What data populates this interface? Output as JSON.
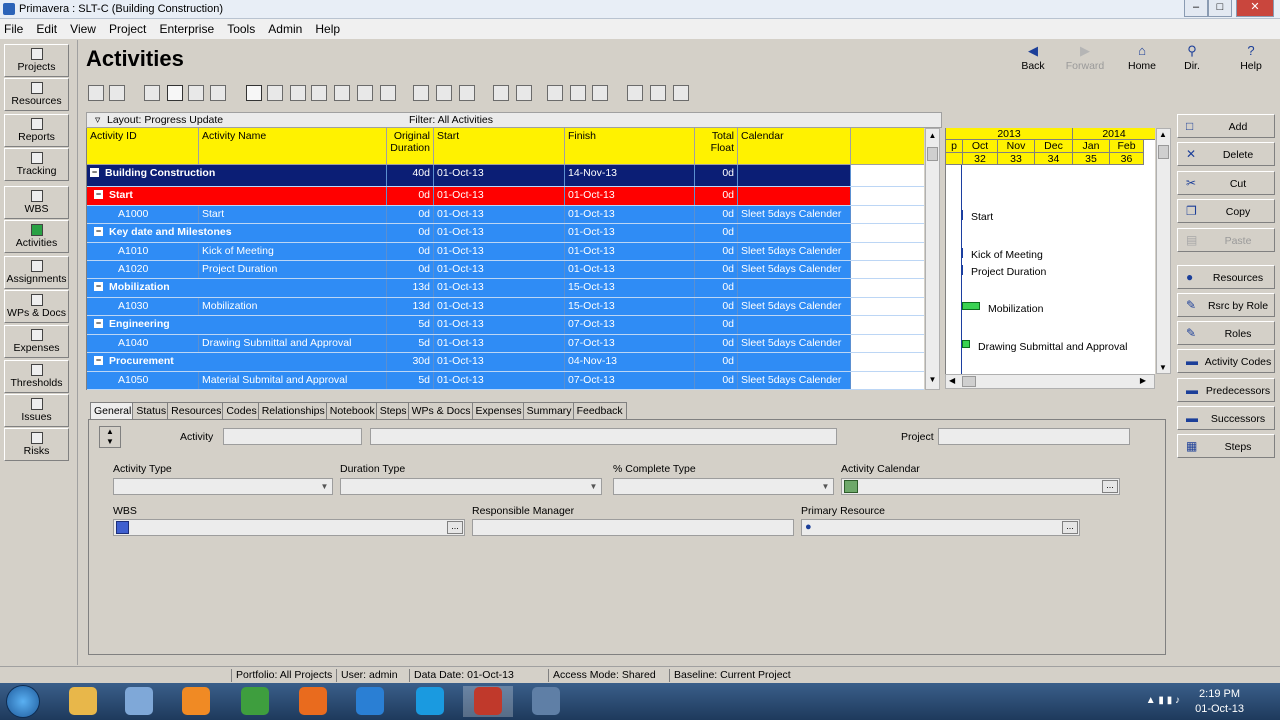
{
  "window": {
    "title": "Primavera : SLT-C (Building Construction)"
  },
  "menu": [
    "File",
    "Edit",
    "View",
    "Project",
    "Enterprise",
    "Tools",
    "Admin",
    "Help"
  ],
  "leftnav": [
    {
      "label": "Projects",
      "icon": "projects-icon"
    },
    {
      "label": "Resources",
      "icon": "resources-icon"
    },
    {
      "label": "Reports",
      "icon": "reports-icon"
    },
    {
      "label": "Tracking",
      "icon": "tracking-icon"
    },
    {
      "label": "WBS",
      "icon": "wbs-icon"
    },
    {
      "label": "Activities",
      "icon": "activities-icon"
    },
    {
      "label": "Assignments",
      "icon": "assignments-icon"
    },
    {
      "label": "WPs & Docs",
      "icon": "wps-docs-icon"
    },
    {
      "label": "Expenses",
      "icon": "expenses-icon"
    },
    {
      "label": "Thresholds",
      "icon": "thresholds-icon"
    },
    {
      "label": "Issues",
      "icon": "issues-icon"
    },
    {
      "label": "Risks",
      "icon": "risks-icon"
    }
  ],
  "header": {
    "title": "Activities",
    "nav": [
      {
        "label": "Back",
        "icon": "back-icon",
        "glyph": "◀",
        "disabled": false
      },
      {
        "label": "Forward",
        "icon": "forward-icon",
        "glyph": "▶",
        "disabled": true
      },
      {
        "label": "Home",
        "icon": "home-icon",
        "glyph": "⌂",
        "disabled": false
      },
      {
        "label": "Dir.",
        "icon": "directory-icon",
        "glyph": "⚲",
        "disabled": false
      },
      {
        "label": "Help",
        "icon": "help-icon",
        "glyph": "?",
        "disabled": false
      }
    ]
  },
  "layoutbar": {
    "layout": "Layout: Progress Update",
    "filter": "Filter: All Activities"
  },
  "grid": {
    "columns": [
      "Activity ID",
      "Activity Name",
      "Original Duration",
      "Start",
      "Finish",
      "Total Float",
      "Calendar"
    ],
    "col_original_1": "Original",
    "col_original_2": "Duration",
    "col_float_1": "Total",
    "col_float_2": "Float",
    "rows": [
      {
        "kind": "project",
        "name": "Building Construction",
        "dur": "40d",
        "start": "01-Oct-13",
        "finish": "14-Nov-13",
        "float": "0d",
        "cal": ""
      },
      {
        "kind": "wbs-red",
        "name": "Start",
        "dur": "0d",
        "start": "01-Oct-13",
        "finish": "01-Oct-13",
        "float": "0d",
        "cal": ""
      },
      {
        "kind": "act",
        "id": "A1000",
        "name": "Start",
        "dur": "0d",
        "start": "01-Oct-13",
        "finish": "01-Oct-13",
        "float": "0d",
        "cal": "Sleet 5days Calender"
      },
      {
        "kind": "wbs",
        "name": "Key date and Milestones",
        "dur": "0d",
        "start": "01-Oct-13",
        "finish": "01-Oct-13",
        "float": "0d",
        "cal": ""
      },
      {
        "kind": "act",
        "id": "A1010",
        "name": "Kick of Meeting",
        "dur": "0d",
        "start": "01-Oct-13",
        "finish": "01-Oct-13",
        "float": "0d",
        "cal": "Sleet 5days Calender"
      },
      {
        "kind": "act",
        "id": "A1020",
        "name": "Project Duration",
        "dur": "0d",
        "start": "01-Oct-13",
        "finish": "01-Oct-13",
        "float": "0d",
        "cal": "Sleet 5days Calender"
      },
      {
        "kind": "wbs",
        "name": "Mobilization",
        "dur": "13d",
        "start": "01-Oct-13",
        "finish": "15-Oct-13",
        "float": "0d",
        "cal": ""
      },
      {
        "kind": "act",
        "id": "A1030",
        "name": "Mobilization",
        "dur": "13d",
        "start": "01-Oct-13",
        "finish": "15-Oct-13",
        "float": "0d",
        "cal": "Sleet 5days Calender"
      },
      {
        "kind": "wbs",
        "name": "Engineering",
        "dur": "5d",
        "start": "01-Oct-13",
        "finish": "07-Oct-13",
        "float": "0d",
        "cal": ""
      },
      {
        "kind": "act",
        "id": "A1040",
        "name": "Drawing Submittal and Approval",
        "dur": "5d",
        "start": "01-Oct-13",
        "finish": "07-Oct-13",
        "float": "0d",
        "cal": "Sleet 5days Calender"
      },
      {
        "kind": "wbs",
        "name": "Procurement",
        "dur": "30d",
        "start": "01-Oct-13",
        "finish": "04-Nov-13",
        "float": "0d",
        "cal": ""
      },
      {
        "kind": "act",
        "id": "A1050",
        "name": "Material Submital and Approval",
        "dur": "5d",
        "start": "01-Oct-13",
        "finish": "07-Oct-13",
        "float": "0d",
        "cal": "Sleet 5days Calender"
      }
    ],
    "colors": {
      "project": "#0b1e75",
      "wbs_red": "#ff0000",
      "row": "#2f8cf5",
      "header": "#fff200"
    }
  },
  "gantt": {
    "years": [
      "2013",
      "2014"
    ],
    "months": [
      "Oct",
      "Nov",
      "Dec",
      "Jan",
      "Feb"
    ],
    "weeks": [
      "32",
      "33",
      "34",
      "35",
      "36"
    ],
    "cut_letter": "p",
    "labels": {
      "start": "Start",
      "kick": "Kick of Meeting",
      "duration": "Project Duration",
      "mobil": "Mobilization",
      "drawing": "Drawing Submittal and Approval"
    }
  },
  "actions": [
    {
      "label": "Add",
      "icon": "add-icon",
      "glyph": "□",
      "disabled": false
    },
    {
      "label": "Delete",
      "icon": "delete-icon",
      "glyph": "✕",
      "disabled": false
    },
    {
      "label": "Cut",
      "icon": "cut-icon",
      "glyph": "✂",
      "disabled": false
    },
    {
      "label": "Copy",
      "icon": "copy-icon",
      "glyph": "❐",
      "disabled": false
    },
    {
      "label": "Paste",
      "icon": "paste-icon",
      "glyph": "▤",
      "disabled": true
    },
    {
      "label": "Resources",
      "icon": "resources-icon",
      "glyph": "●",
      "disabled": false
    },
    {
      "label": "Rsrc by Role",
      "icon": "rsrc-role-icon",
      "glyph": "✎",
      "disabled": false
    },
    {
      "label": "Roles",
      "icon": "roles-icon",
      "glyph": "✎",
      "disabled": false
    },
    {
      "label": "Activity Codes",
      "icon": "activity-codes-icon",
      "glyph": "▬",
      "disabled": false
    },
    {
      "label": "Predecessors",
      "icon": "predecessors-icon",
      "glyph": "▬",
      "disabled": false
    },
    {
      "label": "Successors",
      "icon": "successors-icon",
      "glyph": "▬",
      "disabled": false
    },
    {
      "label": "Steps",
      "icon": "steps-icon",
      "glyph": "▦",
      "disabled": false
    }
  ],
  "details": {
    "tabs": [
      "General",
      "Status",
      "Resources",
      "Codes",
      "Relationships",
      "Notebook",
      "Steps",
      "WPs & Docs",
      "Expenses",
      "Summary",
      "Feedback"
    ],
    "labels": {
      "activity": "Activity",
      "project": "Project",
      "activity_type": "Activity Type",
      "duration_type": "Duration Type",
      "complete_type": "% Complete Type",
      "activity_calendar": "Activity Calendar",
      "wbs": "WBS",
      "responsible_manager": "Responsible Manager",
      "primary_resource": "Primary Resource"
    }
  },
  "statusbar": {
    "portfolio": "Portfolio: All Projects",
    "user": "User: admin",
    "data_date": "Data Date: 01-Oct-13",
    "access": "Access Mode: Shared",
    "baseline": "Baseline: Current Project"
  },
  "taskbar": {
    "time": "2:19 PM",
    "date": "01-Oct-13",
    "apps": [
      {
        "name": "explorer-icon",
        "color": "#e8b74a"
      },
      {
        "name": "control-panel-icon",
        "color": "#7fa8d8"
      },
      {
        "name": "media-player-icon",
        "color": "#f08a24"
      },
      {
        "name": "chrome-icon",
        "color": "#3e9e3e"
      },
      {
        "name": "firefox-icon",
        "color": "#e96b1e"
      },
      {
        "name": "ie-icon",
        "color": "#2a7fd4"
      },
      {
        "name": "skype-icon",
        "color": "#1a9ae0"
      },
      {
        "name": "primavera-icon",
        "color": "#c0392b"
      },
      {
        "name": "film-icon",
        "color": "#5f7fa6"
      }
    ]
  }
}
